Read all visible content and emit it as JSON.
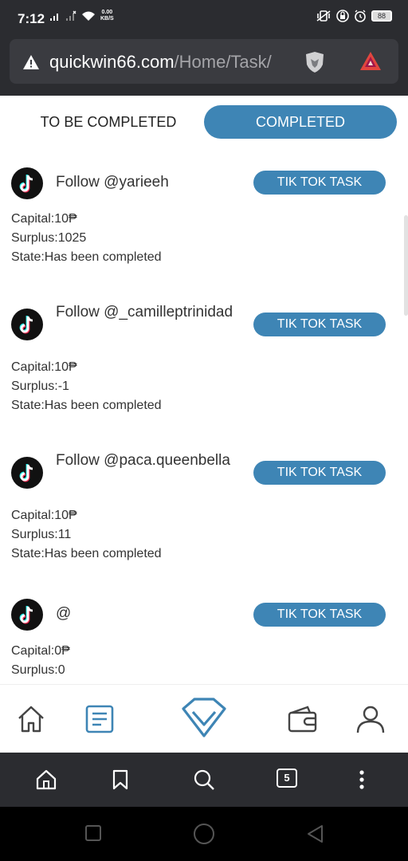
{
  "status_bar": {
    "time": "7:12",
    "net_speed_value": "0.00",
    "net_speed_unit": "KB/S",
    "battery": "88"
  },
  "browser": {
    "url_host": "quickwin66.com",
    "url_path": "/Home/Task/",
    "open_tabs": "5"
  },
  "tabs": {
    "to_be_completed": "TO BE COMPLETED",
    "completed": "COMPLETED"
  },
  "tasks": [
    {
      "title": "Follow @yarieeh",
      "button": "TIK TOK TASK",
      "capital": "Capital:10₱",
      "surplus": "Surplus:1025",
      "state": "State:Has been completed"
    },
    {
      "title": "Follow @_camilleptrinidad",
      "button": "TIK TOK TASK",
      "capital": "Capital:10₱",
      "surplus": "Surplus:-1",
      "state": "State:Has been completed"
    },
    {
      "title": "Follow @paca.queenbella",
      "button": "TIK TOK TASK",
      "capital": "Capital:10₱",
      "surplus": "Surplus:11",
      "state": "State:Has been completed"
    },
    {
      "title": "@",
      "button": "TIK TOK TASK",
      "capital": "Capital:0₱",
      "surplus": "Surplus:0",
      "state": ""
    }
  ],
  "icons": {
    "tiktok": "tiktok-logo-icon",
    "home": "home-icon",
    "task": "task-list-icon",
    "vip": "diamond-icon",
    "wallet": "wallet-icon",
    "user": "user-icon"
  },
  "colors": {
    "accent": "#3e85b5",
    "browser_dark": "#2b2c30"
  }
}
